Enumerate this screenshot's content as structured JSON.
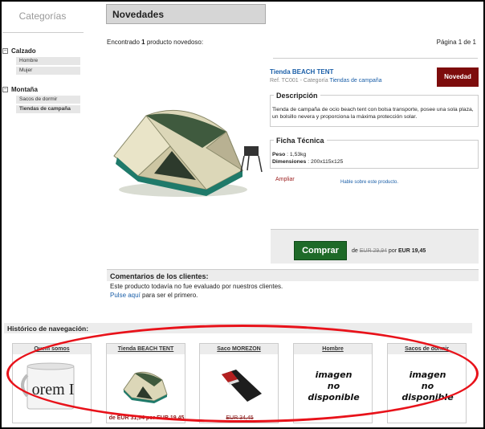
{
  "sidebar": {
    "title": "Categorías",
    "groups": [
      {
        "name": "Calzado",
        "toggle": "−",
        "items": [
          "Hombre",
          "Mujer"
        ]
      },
      {
        "name": "Montaña",
        "toggle": "−",
        "items": [
          "Sacos de dormir",
          "Tiendas de campaña"
        ]
      }
    ]
  },
  "header": {
    "title": "Novedades"
  },
  "results": {
    "prefix": "Encontrado ",
    "count": "1",
    "suffix": " producto novedoso:",
    "page": "Página 1 de 1"
  },
  "product": {
    "name": "Tienda BEACH TENT",
    "ref_label": "Ref. TC001 - Categoría ",
    "category": "Tiendas de campaña",
    "badge": "Novedad",
    "description_label": "Descripción",
    "description": "Tienda de campaña de ocio beach tent con bolsa transporte, posee una sola plaza, un bolsillo nevera y proporciona la máxima protección solar.",
    "specs_label": "Ficha Técnica",
    "weight_label": "Peso",
    "weight_value": ": 1,53kg",
    "dims_label": "Dimensiones",
    "dims_value": ": 200x115x125",
    "enlarge": "Ampliar",
    "talk_link": "Hable sobre este producto.",
    "buy_label": "Comprar",
    "price_prefix": "de ",
    "price_old": "EUR 29,94",
    "price_mid": " por ",
    "price_new": "EUR 19,45"
  },
  "comments": {
    "title": "Comentarios de los clientes:",
    "text": "Este producto todavía no fue evaluado por nuestros clientes.",
    "link": "Pulse aquí",
    "link_suffix": " para ser el primero."
  },
  "history": {
    "title": "Histórico de navegación:",
    "cards": [
      {
        "title": "Quem somos",
        "thumb": "mug-image",
        "mug_text": "orem I",
        "price": ""
      },
      {
        "title": "Tienda BEACH TENT",
        "thumb": "tent-image",
        "price": "de EUR 31,94 por EUR 19,45"
      },
      {
        "title": "Saco MOREZON",
        "thumb": "sleeping-bag-image",
        "price": "EUR 34,45"
      },
      {
        "title": "Hombre",
        "thumb": "no-image",
        "no_image": [
          "imagen",
          "no",
          "disponible"
        ],
        "price": ""
      },
      {
        "title": "Sacos de dormir",
        "thumb": "no-image",
        "no_image": [
          "imagen",
          "no",
          "disponible"
        ],
        "price": ""
      }
    ]
  },
  "colors": {
    "badge": "#7d0c0c",
    "buy": "#1e6a28",
    "link": "#1b5fa8",
    "annotation": "#e8121a"
  }
}
